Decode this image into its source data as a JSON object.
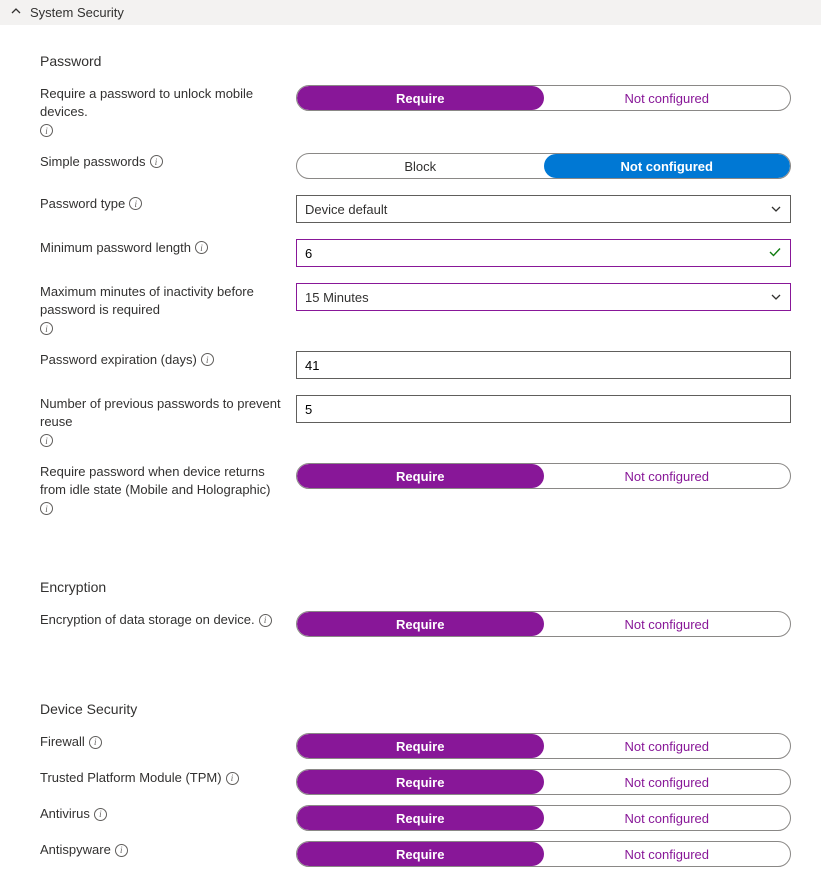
{
  "header": {
    "title": "System Security"
  },
  "groups": {
    "password_label": "Password",
    "encryption_label": "Encryption",
    "device_security_label": "Device Security"
  },
  "toggle_options": {
    "require": "Require",
    "not_configured": "Not configured",
    "block": "Block"
  },
  "rows": {
    "require_password_unlock": {
      "label": "Require a password to unlock mobile devices.",
      "selected": "Require"
    },
    "simple_passwords": {
      "label": "Simple passwords",
      "selected": "Not configured"
    },
    "password_type": {
      "label": "Password type",
      "value": "Device default"
    },
    "min_password_length": {
      "label": "Minimum password length",
      "value": "6"
    },
    "max_inactivity": {
      "label": "Maximum minutes of inactivity before password is required",
      "value": "15 Minutes"
    },
    "password_expiration": {
      "label": "Password expiration (days)",
      "value": "41"
    },
    "prev_passwords": {
      "label": "Number of previous passwords to prevent reuse",
      "value": "5"
    },
    "require_idle_return": {
      "label": "Require password when device returns from idle state (Mobile and Holographic)",
      "selected": "Require"
    },
    "encryption_storage": {
      "label": "Encryption of data storage on device.",
      "selected": "Require"
    },
    "firewall": {
      "label": "Firewall",
      "selected": "Require"
    },
    "tpm": {
      "label": "Trusted Platform Module (TPM)",
      "selected": "Require"
    },
    "antivirus": {
      "label": "Antivirus",
      "selected": "Require"
    },
    "antispyware": {
      "label": "Antispyware",
      "selected": "Require"
    }
  }
}
